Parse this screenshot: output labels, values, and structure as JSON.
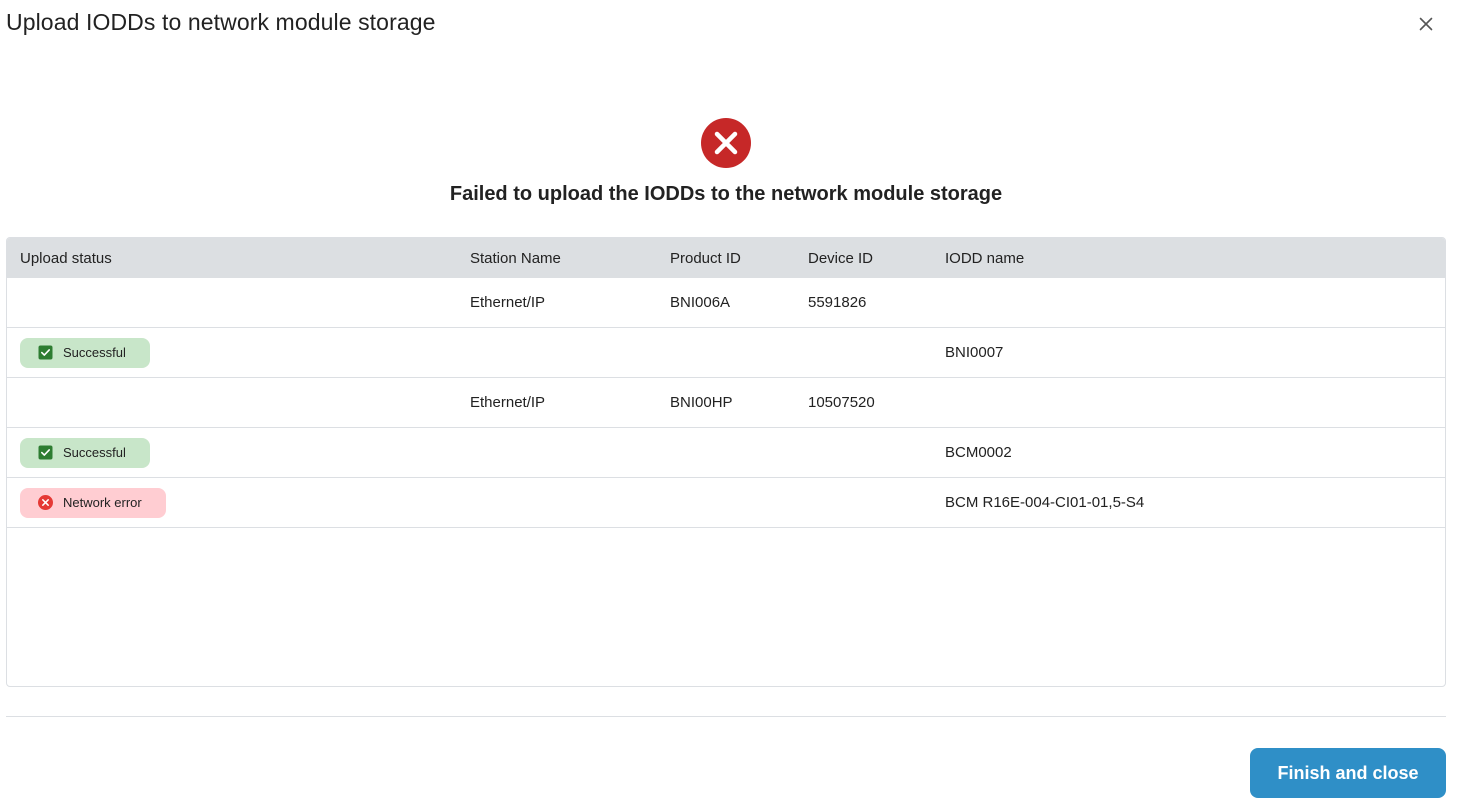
{
  "dialog": {
    "title": "Upload IODDs to network module storage",
    "close_icon": "close-icon"
  },
  "result": {
    "icon": "error-circle-icon",
    "message": "Failed to upload the IODDs to the network module storage"
  },
  "table": {
    "columns": [
      "Upload status",
      "Station Name",
      "Product ID",
      "Device ID",
      "IODD name"
    ],
    "rows": [
      {
        "status": "",
        "station": "Ethernet/IP",
        "product": "BNI006A",
        "device": "5591826",
        "iodd": ""
      },
      {
        "status": "Successful",
        "station": "",
        "product": "",
        "device": "",
        "iodd": "BNI0007"
      },
      {
        "status": "",
        "station": "Ethernet/IP",
        "product": "BNI00HP",
        "device": "10507520",
        "iodd": ""
      },
      {
        "status": "Successful",
        "station": "",
        "product": "",
        "device": "",
        "iodd": "BCM0002"
      },
      {
        "status": "Network error",
        "station": "",
        "product": "",
        "device": "",
        "iodd": "BCM R16E-004-CI01-01,5-S4"
      }
    ]
  },
  "footer": {
    "finish_label": "Finish and close"
  },
  "colors": {
    "error": "#c62828",
    "success_badge_bg": "#c8e6c9",
    "success_icon": "#2e7d32",
    "error_badge_bg": "#ffcdd2",
    "error_icon": "#e53935",
    "header_bg": "#dcdfe2",
    "primary_button": "#2f8fc7"
  }
}
